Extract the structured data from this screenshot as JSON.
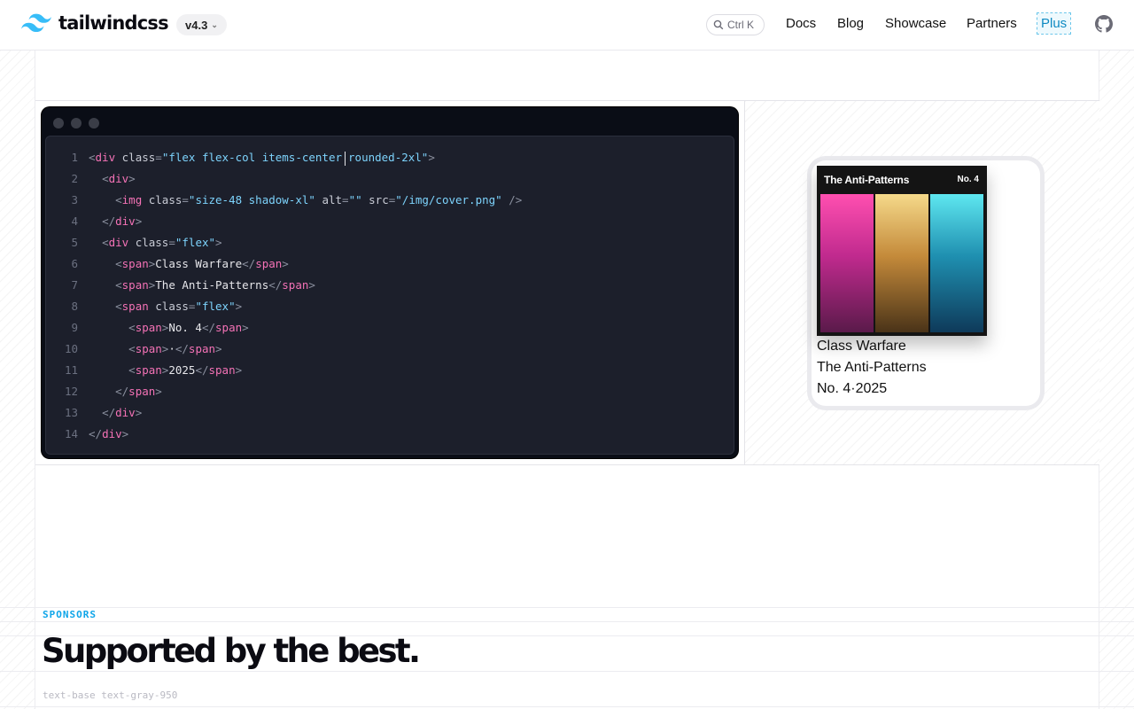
{
  "header": {
    "brand": "tailwindcss",
    "version": "v4.3",
    "search_shortcut": "Ctrl K",
    "nav": [
      "Docs",
      "Blog",
      "Showcase",
      "Partners",
      "Plus"
    ],
    "accent_color": "#38bdf8"
  },
  "editor": {
    "lines": [
      {
        "n": "1"
      },
      {
        "n": "2"
      },
      {
        "n": "3"
      },
      {
        "n": "4"
      },
      {
        "n": "5"
      },
      {
        "n": "6"
      },
      {
        "n": "7"
      },
      {
        "n": "8"
      },
      {
        "n": "9"
      },
      {
        "n": "10"
      },
      {
        "n": "11"
      },
      {
        "n": "12"
      },
      {
        "n": "13"
      },
      {
        "n": "14"
      }
    ],
    "tokens": {
      "l1_class": "\"flex flex-col items-center rounded-2xl\"",
      "l3_class": "\"size-48 shadow-xl\"",
      "l3_alt": "\"\"",
      "l3_src": "\"/img/cover.png\"",
      "l5_class": "\"flex\"",
      "l6_text": "Class Warfare",
      "l7_text": "The Anti-Patterns",
      "l8_class": "\"flex\"",
      "l9_text": "No. 4",
      "l10_text": "·",
      "l11_text": "2025"
    }
  },
  "preview": {
    "cover_title": "The Anti-Patterns",
    "cover_number": "No. 4",
    "song": "Class Warfare",
    "band": "The Anti-Patterns",
    "issue": "No. 4·2025"
  },
  "sponsors": {
    "label": "SPONSORS",
    "title": "Supported by the best.",
    "hint": "text-base text-gray-950"
  }
}
